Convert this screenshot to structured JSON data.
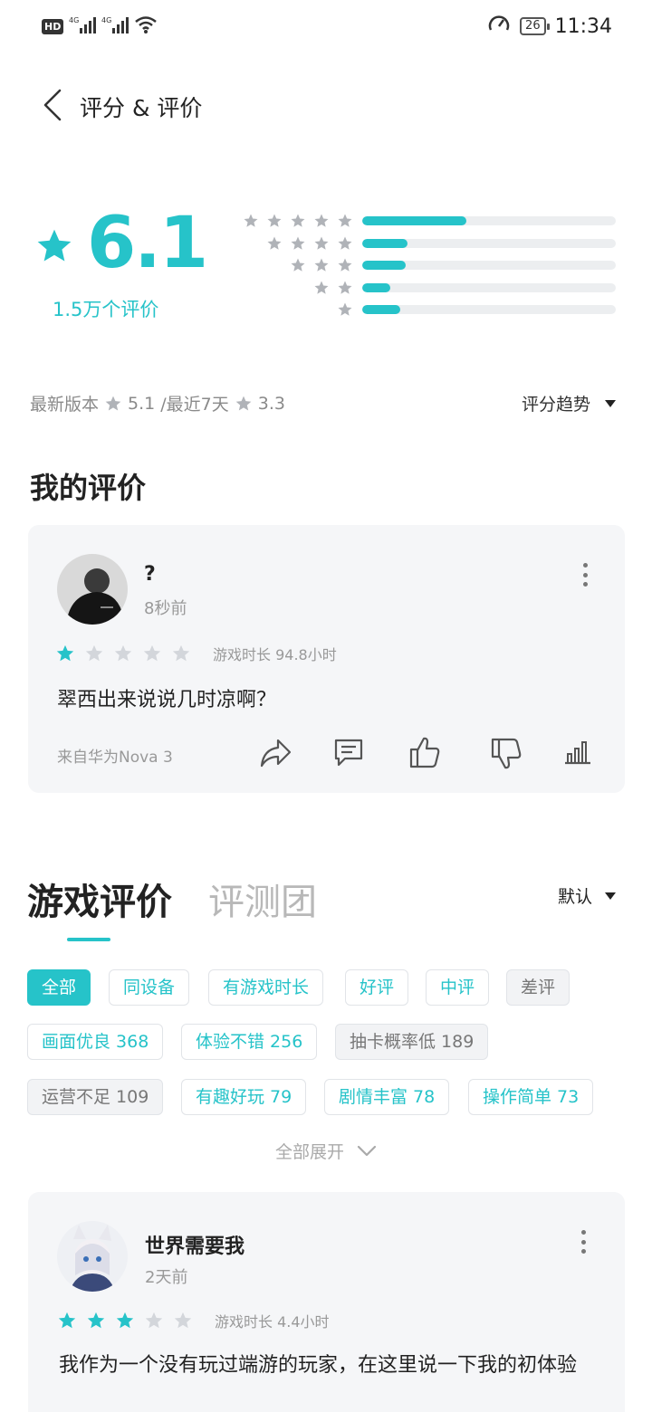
{
  "status_bar": {
    "hd": "HD",
    "net1": "4G",
    "net2": "4G",
    "battery": "26",
    "time": "11:34"
  },
  "header": {
    "title": "评分 & 评价"
  },
  "summary": {
    "score": "6.1",
    "count": "1.5万个评价",
    "distribution": [
      {
        "stars": 5,
        "fraction": 0.41
      },
      {
        "stars": 4,
        "fraction": 0.18
      },
      {
        "stars": 3,
        "fraction": 0.17
      },
      {
        "stars": 2,
        "fraction": 0.11
      },
      {
        "stars": 1,
        "fraction": 0.15
      }
    ],
    "latest_label": "最新版本",
    "latest_score": "5.1",
    "recent_label": "/最近7天",
    "recent_score": "3.3",
    "trend_label": "评分趋势"
  },
  "my_review": {
    "section_title": "我的评价",
    "username": "?",
    "time": "8秒前",
    "stars": 1,
    "playtime": "游戏时长 94.8小时",
    "text": "翠西出来说说几时凉啊？",
    "device": "来自华为Nova 3"
  },
  "game_reviews": {
    "tab_active": "游戏评价",
    "tab_inactive": "评测团",
    "sort_label": "默认",
    "chips": [
      {
        "label": "全部",
        "state": "active"
      },
      {
        "label": "同设备",
        "state": "normal"
      },
      {
        "label": "有游戏时长",
        "state": "normal"
      },
      {
        "label": "好评",
        "state": "normal"
      },
      {
        "label": "中评",
        "state": "normal"
      },
      {
        "label": "差评",
        "state": "gray"
      },
      {
        "label": "画面优良 368",
        "state": "normal"
      },
      {
        "label": "体验不错 256",
        "state": "normal"
      },
      {
        "label": "抽卡概率低 189",
        "state": "gray"
      },
      {
        "label": "运营不足 109",
        "state": "gray"
      },
      {
        "label": "有趣好玩 79",
        "state": "normal"
      },
      {
        "label": "剧情丰富 78",
        "state": "normal"
      },
      {
        "label": "操作简单 73",
        "state": "normal"
      }
    ],
    "expand_label": "全部展开"
  },
  "review": {
    "username": "世界需要我",
    "time": "2天前",
    "stars": 3,
    "playtime": "游戏时长 4.4小时",
    "text": "我作为一个没有玩过端游的玩家，在这里说一下我的初体验"
  },
  "colors": {
    "accent": "#26c3c9",
    "gray_star": "#d3d6db",
    "card_bg": "#f5f6f8"
  }
}
